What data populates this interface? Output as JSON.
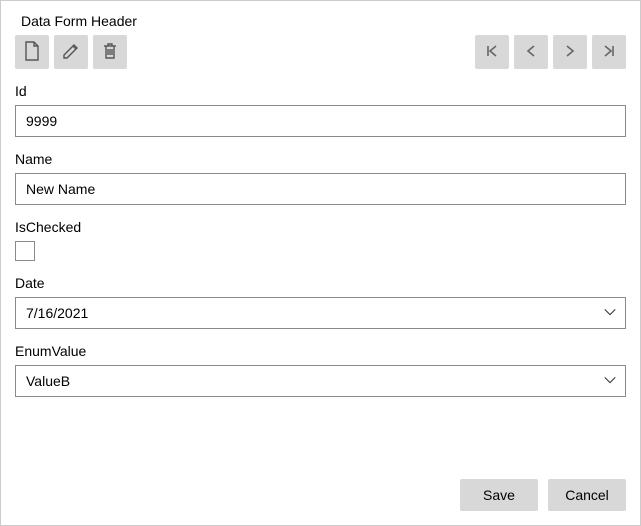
{
  "header": {
    "title": "Data Form Header"
  },
  "fields": {
    "id": {
      "label": "Id",
      "value": "9999"
    },
    "name": {
      "label": "Name",
      "value": "New Name"
    },
    "isChecked": {
      "label": "IsChecked",
      "value": false
    },
    "date": {
      "label": "Date",
      "value": "7/16/2021"
    },
    "enumValue": {
      "label": "EnumValue",
      "value": "ValueB"
    }
  },
  "buttons": {
    "save": "Save",
    "cancel": "Cancel"
  }
}
